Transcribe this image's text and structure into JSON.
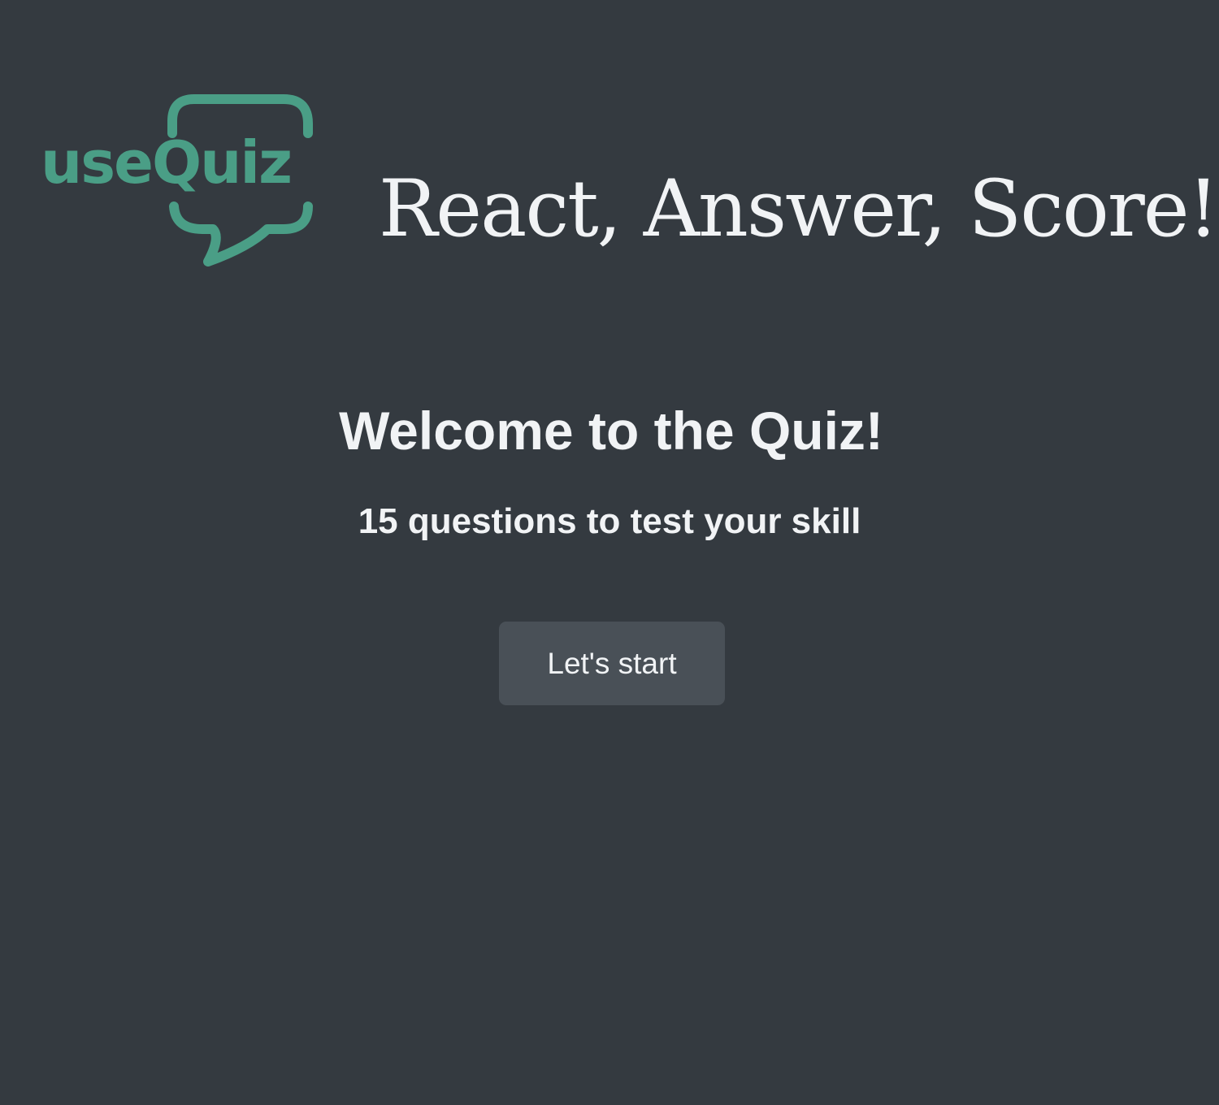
{
  "header": {
    "logo_text": "useQuiz",
    "logo_icon": "speech-bubble-icon",
    "tagline": "React, Answer, Score!"
  },
  "start": {
    "title": "Welcome to the Quiz!",
    "subtitle": "15 questions to test your skill",
    "button_label": "Let's start"
  },
  "colors": {
    "background": "#343a40",
    "text": "#f1f3f5",
    "brand": "#4a9e86",
    "button": "#495057"
  }
}
